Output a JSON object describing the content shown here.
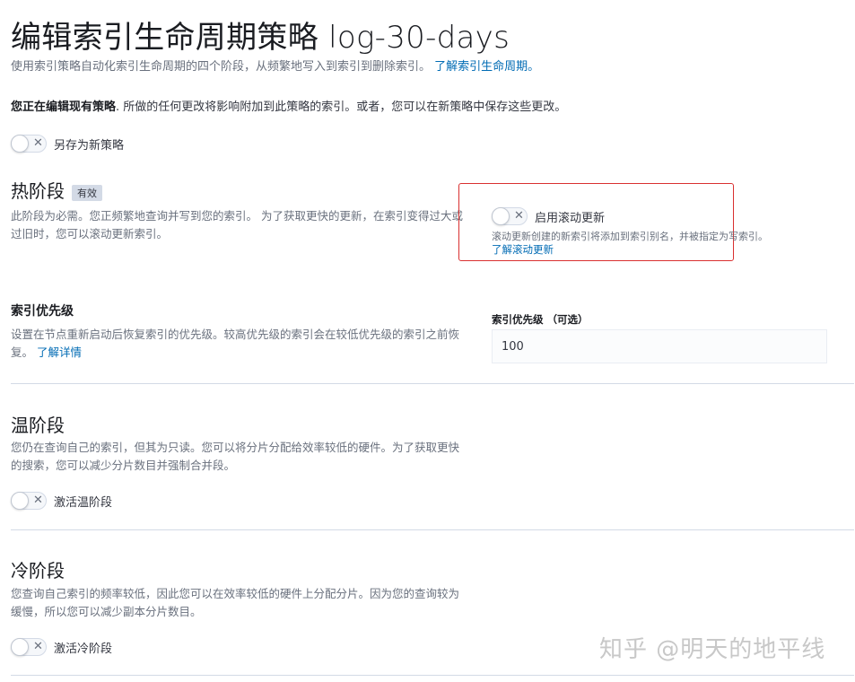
{
  "header": {
    "title": "编辑索引生命周期策略 log-30-days",
    "subtitle": "使用索引策略自动化索引生命周期的四个阶段，从频繁地写入到索引到删除索引。",
    "subtitle_link": "了解索引生命周期。"
  },
  "notice": {
    "bold": "您正在编辑现有策略",
    "rest": ". 所做的任何更改将影响附加到此策略的索引。或者，您可以在新策略中保存这些更改。"
  },
  "save_as_new": {
    "label": "另存为新策略",
    "checked": false
  },
  "hot": {
    "title": "热阶段",
    "badge": "有效",
    "description": "此阶段为必需。您正频繁地查询并写到您的索引。 为了获取更快的更新，在索引变得过大或过旧时，您可以滚动更新索引。",
    "rollover": {
      "label": "启用滚动更新",
      "checked": false,
      "help": "滚动更新创建的新索引将添加到索引别名，并被指定为写索引。",
      "link": "了解滚动更新"
    }
  },
  "priority": {
    "title": "索引优先级",
    "description": "设置在节点重新启动后恢复索引的优先级。较高优先级的索引会在较低优先级的索引之前恢复。",
    "link": "了解详情",
    "field_label": "索引优先级 （可选）",
    "value": "100"
  },
  "warm": {
    "title": "温阶段",
    "description": "您仍在查询自己的索引，但其为只读。您可以将分片分配给效率较低的硬件。为了获取更快的搜索，您可以减少分片数目并强制合并段。",
    "toggle_label": "激活温阶段",
    "checked": false
  },
  "cold": {
    "title": "冷阶段",
    "description": "您查询自己索引的频率较低，因此您可以在效率较低的硬件上分配分片。因为您的查询较为缓慢，所以您可以减少副本分片数目。",
    "toggle_label": "激活冷阶段",
    "checked": false
  },
  "watermark": "知乎 @明天的地平线",
  "colors": {
    "link": "#006bb4",
    "highlight_border": "#d93030",
    "badge_bg": "#d3dae6"
  },
  "icons": {
    "toggle_off": "cross-icon"
  }
}
